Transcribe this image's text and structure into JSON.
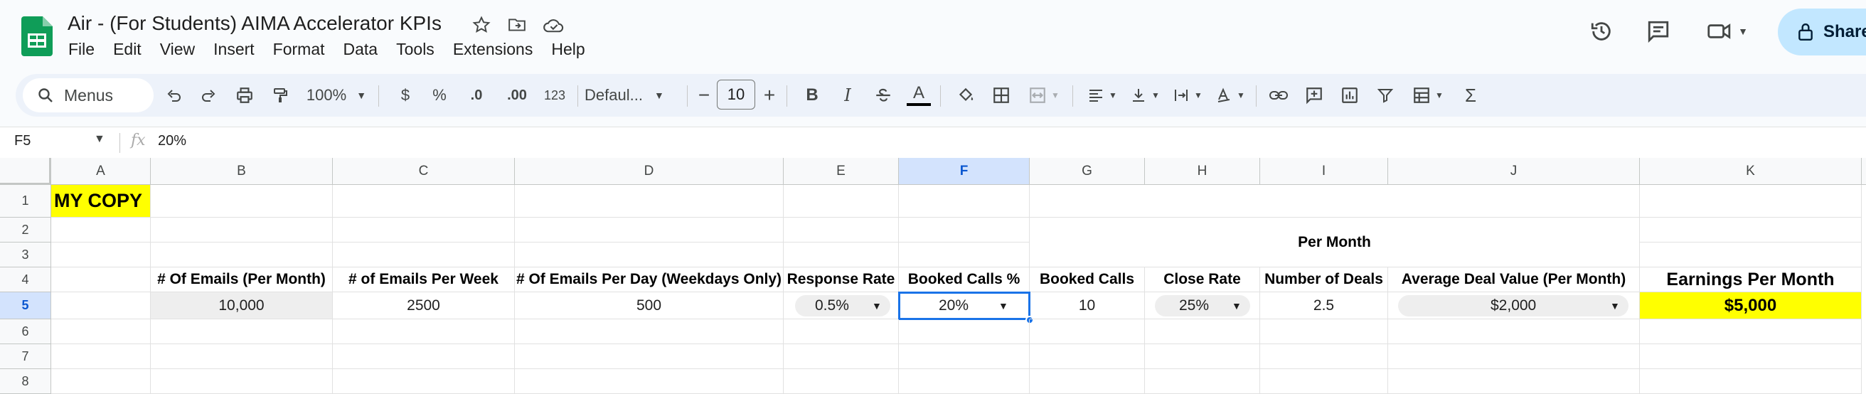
{
  "app": {
    "doc_title": "Air - (For Students) AIMA Accelerator KPIs",
    "menus": [
      "File",
      "Edit",
      "View",
      "Insert",
      "Format",
      "Data",
      "Tools",
      "Extensions",
      "Help"
    ],
    "share_label": "Share"
  },
  "toolbar": {
    "search_label": "Menus",
    "zoom": "100%",
    "currency": "$",
    "percent": "%",
    "decrease_decimal": ".0",
    "increase_decimal": ".00",
    "number_format": "123",
    "font": "Defaul...",
    "font_size": "10",
    "bold": "B",
    "italic": "I",
    "sum": "Σ"
  },
  "formula_bar": {
    "name_box": "F5",
    "fx": "fx",
    "value": "20%"
  },
  "grid": {
    "columns": [
      "A",
      "B",
      "C",
      "D",
      "E",
      "F",
      "G",
      "H",
      "I",
      "J",
      "K"
    ],
    "rows": [
      "1",
      "2",
      "3",
      "4",
      "5",
      "6",
      "7",
      "8"
    ],
    "a1": "MY COPY",
    "per_month": "Per Month",
    "headers": {
      "b": "# Of Emails (Per Month)",
      "c": "# of Emails Per Week",
      "d": "# Of Emails Per Day (Weekdays Only)",
      "e": "Response Rate",
      "f": "Booked Calls %",
      "g": "Booked Calls",
      "h": "Close Rate",
      "i": "Number of Deals",
      "j": "Average Deal Value (Per Month)",
      "k": "Earnings Per Month"
    },
    "values": {
      "b": "10,000",
      "c": "2500",
      "d": "500",
      "e": "0.5%",
      "f": "20%",
      "g": "10",
      "h": "25%",
      "i": "2.5",
      "j": "$2,000",
      "k": "$5,000"
    }
  },
  "colors": {
    "yellow": "#ffff00",
    "selection": "#1a73e8",
    "share_bg": "#c2e7ff",
    "sheets_green": "#0f9d58"
  }
}
